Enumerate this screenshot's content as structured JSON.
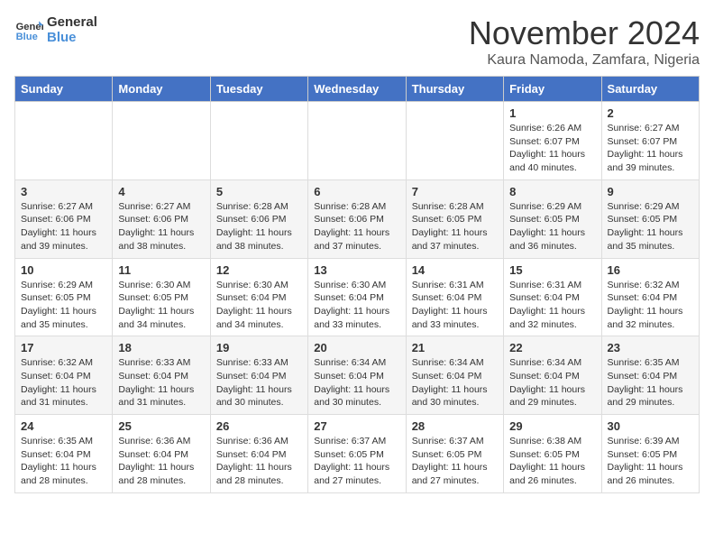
{
  "header": {
    "logo_line1": "General",
    "logo_line2": "Blue",
    "title": "November 2024",
    "subtitle": "Kaura Namoda, Zamfara, Nigeria"
  },
  "days_of_week": [
    "Sunday",
    "Monday",
    "Tuesday",
    "Wednesday",
    "Thursday",
    "Friday",
    "Saturday"
  ],
  "weeks": [
    [
      {
        "day": "",
        "info": ""
      },
      {
        "day": "",
        "info": ""
      },
      {
        "day": "",
        "info": ""
      },
      {
        "day": "",
        "info": ""
      },
      {
        "day": "",
        "info": ""
      },
      {
        "day": "1",
        "info": "Sunrise: 6:26 AM\nSunset: 6:07 PM\nDaylight: 11 hours and 40 minutes."
      },
      {
        "day": "2",
        "info": "Sunrise: 6:27 AM\nSunset: 6:07 PM\nDaylight: 11 hours and 39 minutes."
      }
    ],
    [
      {
        "day": "3",
        "info": "Sunrise: 6:27 AM\nSunset: 6:06 PM\nDaylight: 11 hours and 39 minutes."
      },
      {
        "day": "4",
        "info": "Sunrise: 6:27 AM\nSunset: 6:06 PM\nDaylight: 11 hours and 38 minutes."
      },
      {
        "day": "5",
        "info": "Sunrise: 6:28 AM\nSunset: 6:06 PM\nDaylight: 11 hours and 38 minutes."
      },
      {
        "day": "6",
        "info": "Sunrise: 6:28 AM\nSunset: 6:06 PM\nDaylight: 11 hours and 37 minutes."
      },
      {
        "day": "7",
        "info": "Sunrise: 6:28 AM\nSunset: 6:05 PM\nDaylight: 11 hours and 37 minutes."
      },
      {
        "day": "8",
        "info": "Sunrise: 6:29 AM\nSunset: 6:05 PM\nDaylight: 11 hours and 36 minutes."
      },
      {
        "day": "9",
        "info": "Sunrise: 6:29 AM\nSunset: 6:05 PM\nDaylight: 11 hours and 35 minutes."
      }
    ],
    [
      {
        "day": "10",
        "info": "Sunrise: 6:29 AM\nSunset: 6:05 PM\nDaylight: 11 hours and 35 minutes."
      },
      {
        "day": "11",
        "info": "Sunrise: 6:30 AM\nSunset: 6:05 PM\nDaylight: 11 hours and 34 minutes."
      },
      {
        "day": "12",
        "info": "Sunrise: 6:30 AM\nSunset: 6:04 PM\nDaylight: 11 hours and 34 minutes."
      },
      {
        "day": "13",
        "info": "Sunrise: 6:30 AM\nSunset: 6:04 PM\nDaylight: 11 hours and 33 minutes."
      },
      {
        "day": "14",
        "info": "Sunrise: 6:31 AM\nSunset: 6:04 PM\nDaylight: 11 hours and 33 minutes."
      },
      {
        "day": "15",
        "info": "Sunrise: 6:31 AM\nSunset: 6:04 PM\nDaylight: 11 hours and 32 minutes."
      },
      {
        "day": "16",
        "info": "Sunrise: 6:32 AM\nSunset: 6:04 PM\nDaylight: 11 hours and 32 minutes."
      }
    ],
    [
      {
        "day": "17",
        "info": "Sunrise: 6:32 AM\nSunset: 6:04 PM\nDaylight: 11 hours and 31 minutes."
      },
      {
        "day": "18",
        "info": "Sunrise: 6:33 AM\nSunset: 6:04 PM\nDaylight: 11 hours and 31 minutes."
      },
      {
        "day": "19",
        "info": "Sunrise: 6:33 AM\nSunset: 6:04 PM\nDaylight: 11 hours and 30 minutes."
      },
      {
        "day": "20",
        "info": "Sunrise: 6:34 AM\nSunset: 6:04 PM\nDaylight: 11 hours and 30 minutes."
      },
      {
        "day": "21",
        "info": "Sunrise: 6:34 AM\nSunset: 6:04 PM\nDaylight: 11 hours and 30 minutes."
      },
      {
        "day": "22",
        "info": "Sunrise: 6:34 AM\nSunset: 6:04 PM\nDaylight: 11 hours and 29 minutes."
      },
      {
        "day": "23",
        "info": "Sunrise: 6:35 AM\nSunset: 6:04 PM\nDaylight: 11 hours and 29 minutes."
      }
    ],
    [
      {
        "day": "24",
        "info": "Sunrise: 6:35 AM\nSunset: 6:04 PM\nDaylight: 11 hours and 28 minutes."
      },
      {
        "day": "25",
        "info": "Sunrise: 6:36 AM\nSunset: 6:04 PM\nDaylight: 11 hours and 28 minutes."
      },
      {
        "day": "26",
        "info": "Sunrise: 6:36 AM\nSunset: 6:04 PM\nDaylight: 11 hours and 28 minutes."
      },
      {
        "day": "27",
        "info": "Sunrise: 6:37 AM\nSunset: 6:05 PM\nDaylight: 11 hours and 27 minutes."
      },
      {
        "day": "28",
        "info": "Sunrise: 6:37 AM\nSunset: 6:05 PM\nDaylight: 11 hours and 27 minutes."
      },
      {
        "day": "29",
        "info": "Sunrise: 6:38 AM\nSunset: 6:05 PM\nDaylight: 11 hours and 26 minutes."
      },
      {
        "day": "30",
        "info": "Sunrise: 6:39 AM\nSunset: 6:05 PM\nDaylight: 11 hours and 26 minutes."
      }
    ]
  ]
}
